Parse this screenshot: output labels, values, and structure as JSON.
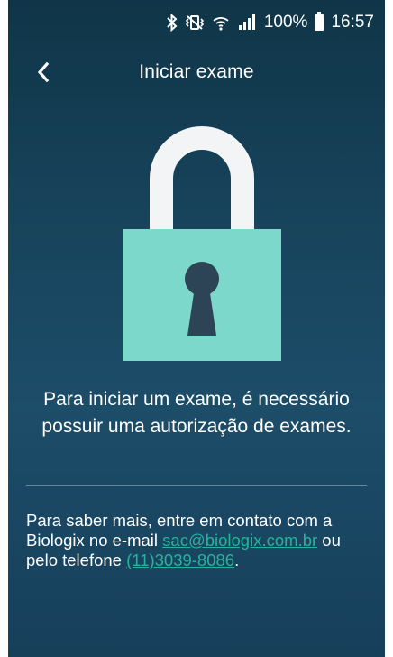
{
  "status_bar": {
    "battery": "100%",
    "time": "16:57",
    "icons": [
      "bluetooth-icon",
      "vibrate-icon",
      "wifi-icon",
      "signal-icon",
      "battery-icon"
    ]
  },
  "app_bar": {
    "title": "Iniciar exame",
    "back_icon": "chevron-left-icon"
  },
  "illustration": {
    "icon": "padlock-icon",
    "colors": {
      "body": "#7dd8cc",
      "shackle": "#f2f4f6",
      "keyhole": "#2c4455"
    }
  },
  "main": {
    "message": "Para iniciar um exame, é necessário possuir uma autorização de exames.",
    "info_prefix": "Para saber mais, entre em contato com a Biologix no e-mail",
    "email": "sac@biologix.com.br",
    "info_middle": "ou pelo telefone",
    "phone": "(11)3039-8086",
    "info_suffix": "."
  },
  "colors": {
    "background_top": "#0f3547",
    "background_bottom": "#1c4d69",
    "link": "#27b39a"
  }
}
